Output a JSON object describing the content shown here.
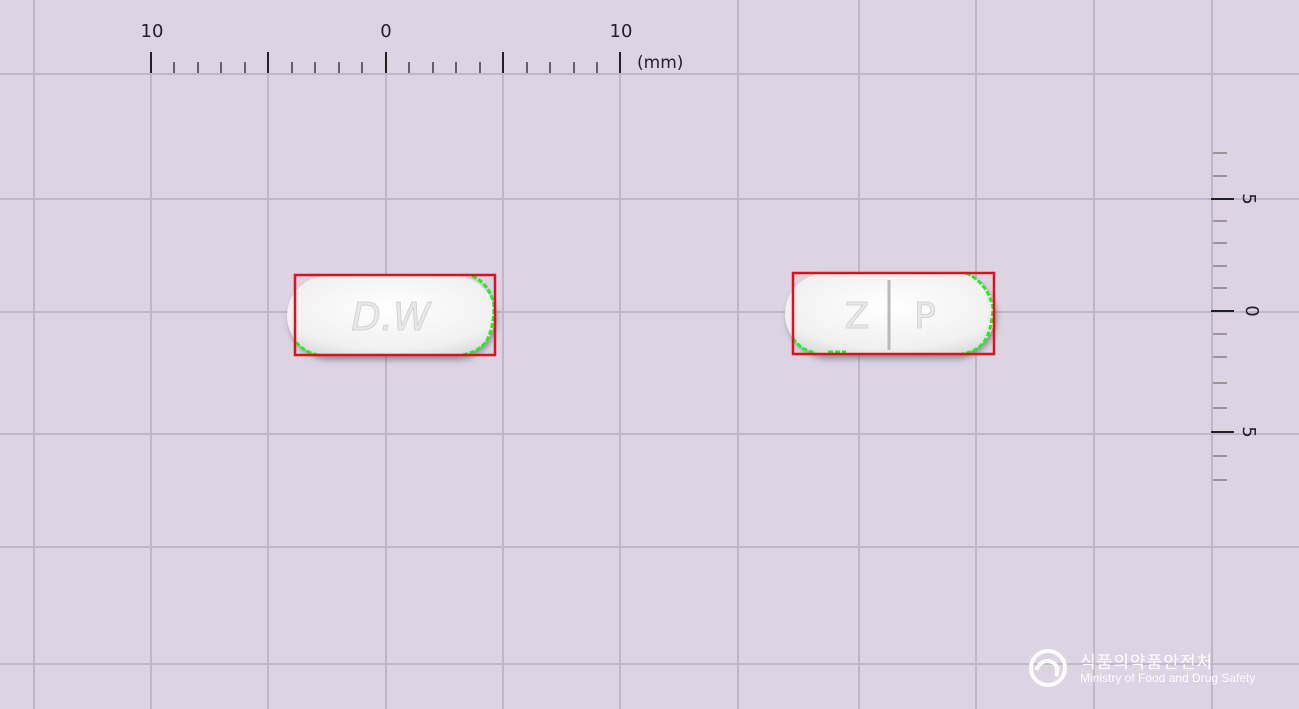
{
  "ruler_top": {
    "labels": [
      "10",
      "0",
      "10"
    ],
    "unit": "(mm)"
  },
  "ruler_right": {
    "labels": [
      "5",
      "0",
      "5"
    ]
  },
  "pills": [
    {
      "imprint": "D.W",
      "score_line": false
    },
    {
      "imprint_left": "Z",
      "imprint_right": "P",
      "score_line": true
    }
  ],
  "watermark": {
    "korean": "식품의약품안전처",
    "english": "Ministry of Food and Drug Safety"
  },
  "colors": {
    "background": "#dcd3e3",
    "grid": "#c0b6c9",
    "ruler": "#222222",
    "bbox": "#e0101a",
    "contour": "#22ee22",
    "pill": "#f3f3f3"
  }
}
